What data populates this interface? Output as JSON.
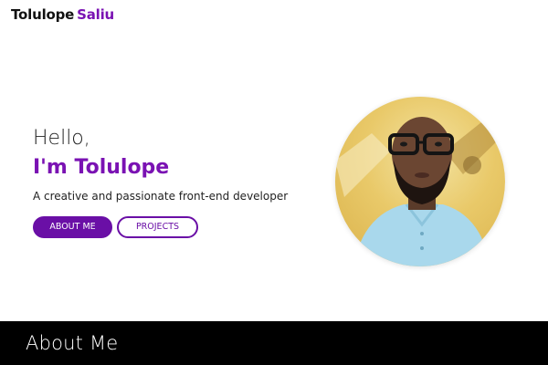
{
  "navbar": {
    "logo_first": "Tolulope",
    "logo_last": "Saliu"
  },
  "hero": {
    "greeting": "Hello,",
    "name": "I'm Tolulope",
    "tagline": "A creative and passionate front-end developer",
    "about_button": "ABOUT ME",
    "projects_button": "PROJECTS"
  },
  "about": {
    "title": "About Me"
  },
  "colors": {
    "brand": "#7a12b3",
    "button_fill": "#6a0fa6",
    "section_bar": "#000000"
  }
}
